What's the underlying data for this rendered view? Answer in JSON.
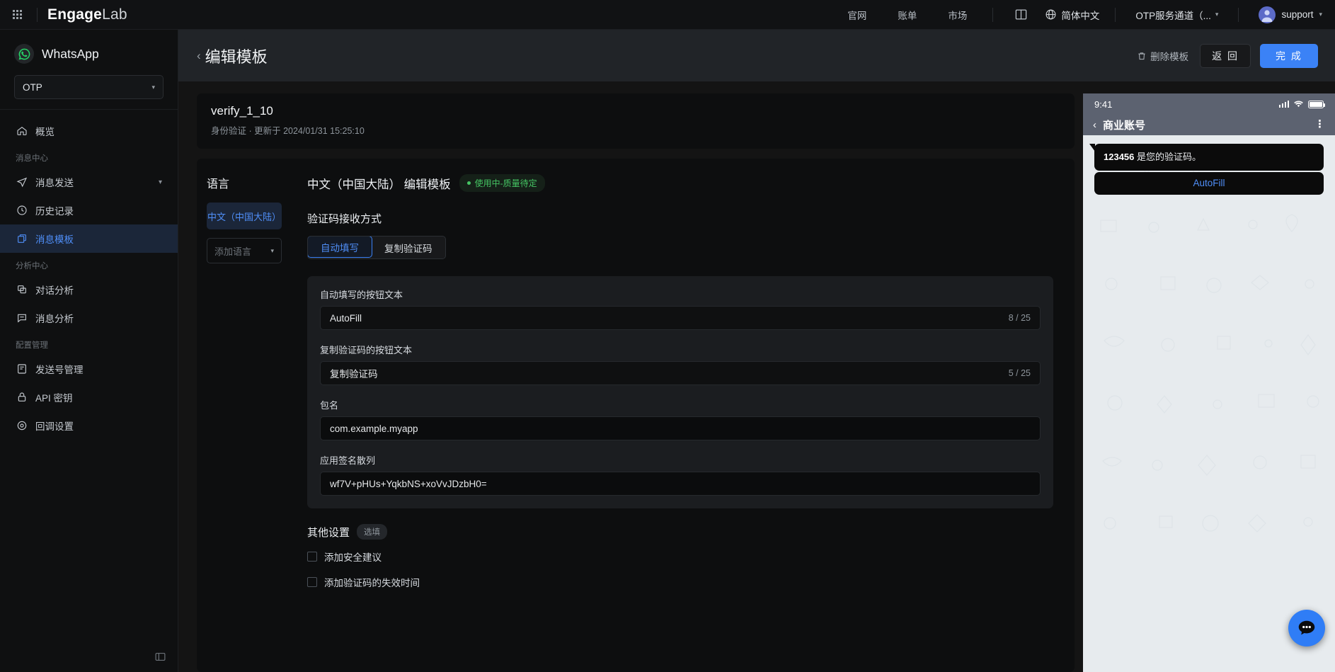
{
  "topbar": {
    "logo_bold": "Engage",
    "logo_light": "Lab",
    "links": [
      {
        "label": "官网",
        "name": "nav-official-site"
      },
      {
        "label": "账单",
        "name": "nav-billing"
      },
      {
        "label": "市场",
        "name": "nav-market"
      }
    ],
    "docs_icon": "book-icon",
    "language": "简体中文",
    "channel": "OTP服务通道（...",
    "user": "support"
  },
  "sidebar": {
    "app_name": "WhatsApp",
    "app_icon": "whatsapp-icon",
    "project_select": "OTP",
    "items": [
      {
        "label": "概览",
        "icon": "home-icon",
        "name": "sidebar-item-overview",
        "active": false,
        "group": null
      },
      {
        "label": "消息中心",
        "group_header": true
      },
      {
        "label": "消息发送",
        "icon": "send-icon",
        "name": "sidebar-item-send",
        "active": false,
        "caret": "▾"
      },
      {
        "label": "历史记录",
        "icon": "history-icon",
        "name": "sidebar-item-history",
        "active": false
      },
      {
        "label": "消息模板",
        "icon": "template-icon",
        "name": "sidebar-item-templates",
        "active": true
      },
      {
        "label": "分析中心",
        "group_header": true
      },
      {
        "label": "对话分析",
        "icon": "chat-analytics-icon",
        "name": "sidebar-item-conversation-analytics",
        "active": false
      },
      {
        "label": "消息分析",
        "icon": "message-analytics-icon",
        "name": "sidebar-item-message-analytics",
        "active": false
      },
      {
        "label": "配置管理",
        "group_header": true
      },
      {
        "label": "发送号管理",
        "icon": "phone-number-icon",
        "name": "sidebar-item-sender-numbers",
        "active": false
      },
      {
        "label": "API 密钥",
        "icon": "lock-icon",
        "name": "sidebar-item-api-key",
        "active": false
      },
      {
        "label": "回调设置",
        "icon": "callback-icon",
        "name": "sidebar-item-callback",
        "active": false
      }
    ],
    "groups": {
      "messaging": "消息中心",
      "analytics": "分析中心",
      "config": "配置管理"
    }
  },
  "page": {
    "title": "编辑模板",
    "delete_label": "删除模板",
    "back_label": "返 回",
    "done_label": "完 成"
  },
  "template": {
    "name": "verify_1_10",
    "meta": "身份验证 · 更新于 2024/01/31 15:25:10"
  },
  "language_panel": {
    "title": "语言",
    "selected": "中文（中国大陆）",
    "add_placeholder": "添加语言"
  },
  "form": {
    "heading": "中文（中国大陆） 编辑模板",
    "status_badge": "使用中-质量待定",
    "status_color": "#45c463",
    "delivery_label": "验证码接收方式",
    "tabs": [
      {
        "label": "自动填写",
        "active": true
      },
      {
        "label": "复制验证码",
        "active": false
      }
    ],
    "fields": [
      {
        "label": "自动填写的按钮文本",
        "value": "AutoFill",
        "counter": "8 / 25",
        "name": "autofill-button-text-input"
      },
      {
        "label": "复制验证码的按钮文本",
        "value": "复制验证码",
        "counter": "5 / 25",
        "name": "copy-code-button-text-input"
      },
      {
        "label": "包名",
        "value": "com.example.myapp",
        "counter": "",
        "name": "package-name-input"
      },
      {
        "label": "应用签名散列",
        "value": "wf7V+pHUs+YqkbNS+xoVvJDzbH0=",
        "counter": "",
        "name": "app-signature-hash-input"
      }
    ],
    "other": {
      "title": "其他设置",
      "optional_badge": "选填",
      "checkboxes": [
        {
          "label": "添加安全建议",
          "checked": false,
          "name": "checkbox-security-advice"
        },
        {
          "label": "添加验证码的失效时间",
          "checked": false,
          "name": "checkbox-code-expiration"
        }
      ]
    }
  },
  "preview": {
    "status_time": "9:41",
    "chat_title": "商业账号",
    "message_code": "123456",
    "message_text": " 是您的验证码。",
    "button_label": "AutoFill",
    "fab_icon": "chat-bubble-icon"
  },
  "colors": {
    "accent": "#3b82f6",
    "active_nav": "#4f8ef7",
    "success": "#45c463",
    "page_bg": "#141414"
  }
}
